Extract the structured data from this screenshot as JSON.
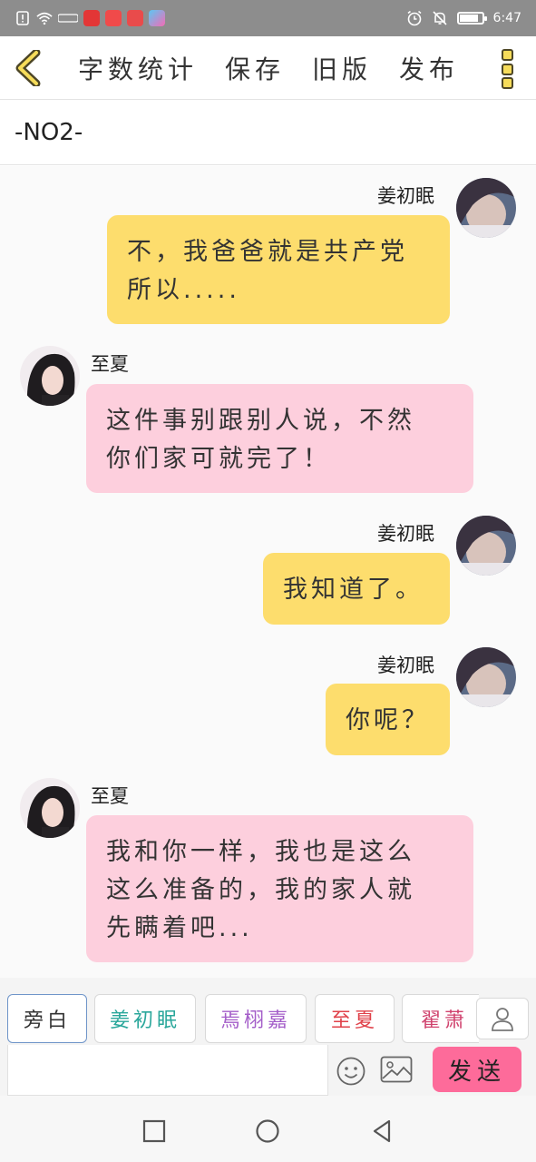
{
  "status_bar": {
    "time": "6:47",
    "colors": {
      "background": "#8d8d8d"
    },
    "left_icons": [
      "sim-alert-icon",
      "wifi-icon",
      "app-icon",
      "app-icon",
      "app-icon",
      "app-icon",
      "app-icon"
    ],
    "right_icons": [
      "alarm-icon",
      "mute-icon",
      "battery-icon"
    ],
    "battery_level": 0.85
  },
  "toolbar": {
    "back_icon": "chevron-left-icon",
    "word_count_label": "字数统计",
    "save_label": "保存",
    "old_version_label": "旧版",
    "publish_label": "发布",
    "more_icon": "more-vertical-icon"
  },
  "chapter": {
    "label": "-NO2-"
  },
  "messages": [
    {
      "side": "right",
      "name": "姜初眠",
      "lines": [
        "不，我爸爸就是共产党",
        "所以....."
      ]
    },
    {
      "side": "left",
      "name": "至夏",
      "lines": [
        "这件事别跟别人说，不然",
        "你们家可就完了！"
      ]
    },
    {
      "side": "right",
      "name": "姜初眠",
      "lines": [
        "我知道了。"
      ]
    },
    {
      "side": "right",
      "name": "姜初眠",
      "lines": [
        "你呢？"
      ]
    },
    {
      "side": "left",
      "name": "至夏",
      "lines": [
        "我和你一样，我也是这么",
        "这么准备的，我的家人就",
        "先瞒着吧..."
      ]
    }
  ],
  "roles": [
    {
      "label": "旁白",
      "color": "#333333",
      "active": true
    },
    {
      "label": "姜初眠",
      "color": "#2aa79b",
      "active": false
    },
    {
      "label": "焉栩嘉",
      "color": "#a45ec9",
      "active": false
    },
    {
      "label": "至夏",
      "color": "#e0424a",
      "active": false
    },
    {
      "label": "翟萧",
      "color": "#d0436e",
      "active": false
    }
  ],
  "input": {
    "value": "",
    "placeholder": ""
  },
  "send_label": "发送",
  "colors": {
    "bubble_self": "#fddd6d",
    "bubble_other": "#fdcfdd",
    "send_button": "#fd6b9a",
    "menu_accent": "#f6dc5a"
  }
}
